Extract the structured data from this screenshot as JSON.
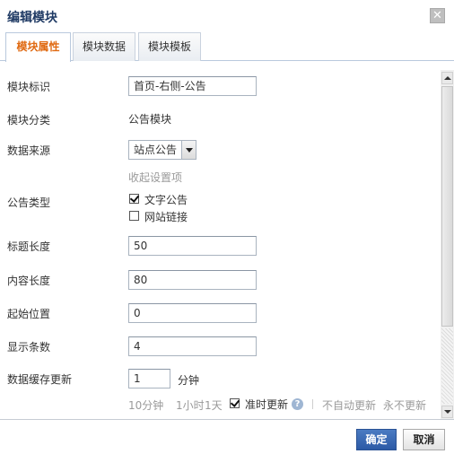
{
  "dialog": {
    "title": "编辑模块",
    "close_glyph": "✕"
  },
  "tabs": [
    {
      "label": "模块属性",
      "active": true
    },
    {
      "label": "模块数据",
      "active": false
    },
    {
      "label": "模块模板",
      "active": false
    }
  ],
  "form": {
    "module_id": {
      "label": "模块标识",
      "value": "首页-右侧-公告"
    },
    "module_category": {
      "label": "模块分类",
      "value": "公告模块"
    },
    "data_source": {
      "label": "数据来源",
      "selected": "站点公告",
      "collapse_link": "收起设置项"
    },
    "notice_type": {
      "label": "公告类型",
      "options": [
        {
          "label": "文字公告",
          "checked": true
        },
        {
          "label": "网站链接",
          "checked": false
        }
      ]
    },
    "title_length": {
      "label": "标题长度",
      "value": "50"
    },
    "content_length": {
      "label": "内容长度",
      "value": "80"
    },
    "start_position": {
      "label": "起始位置",
      "value": "0"
    },
    "display_count": {
      "label": "显示条数",
      "value": "4"
    },
    "cache_refresh": {
      "label": "数据缓存更新",
      "value": "1",
      "unit": "分钟",
      "quick": [
        "10分钟",
        "1小时",
        "1天"
      ],
      "ontime_label": "准时更新",
      "ontime_checked": true,
      "help_glyph": "?",
      "no_auto": "不自动更新",
      "never": "永不更新"
    }
  },
  "footer": {
    "confirm_label": "确定",
    "cancel_label": "取消"
  },
  "colors": {
    "active_tab": "#e06a12",
    "title": "#1f3a64",
    "primary_button": "#2c5aa6"
  }
}
